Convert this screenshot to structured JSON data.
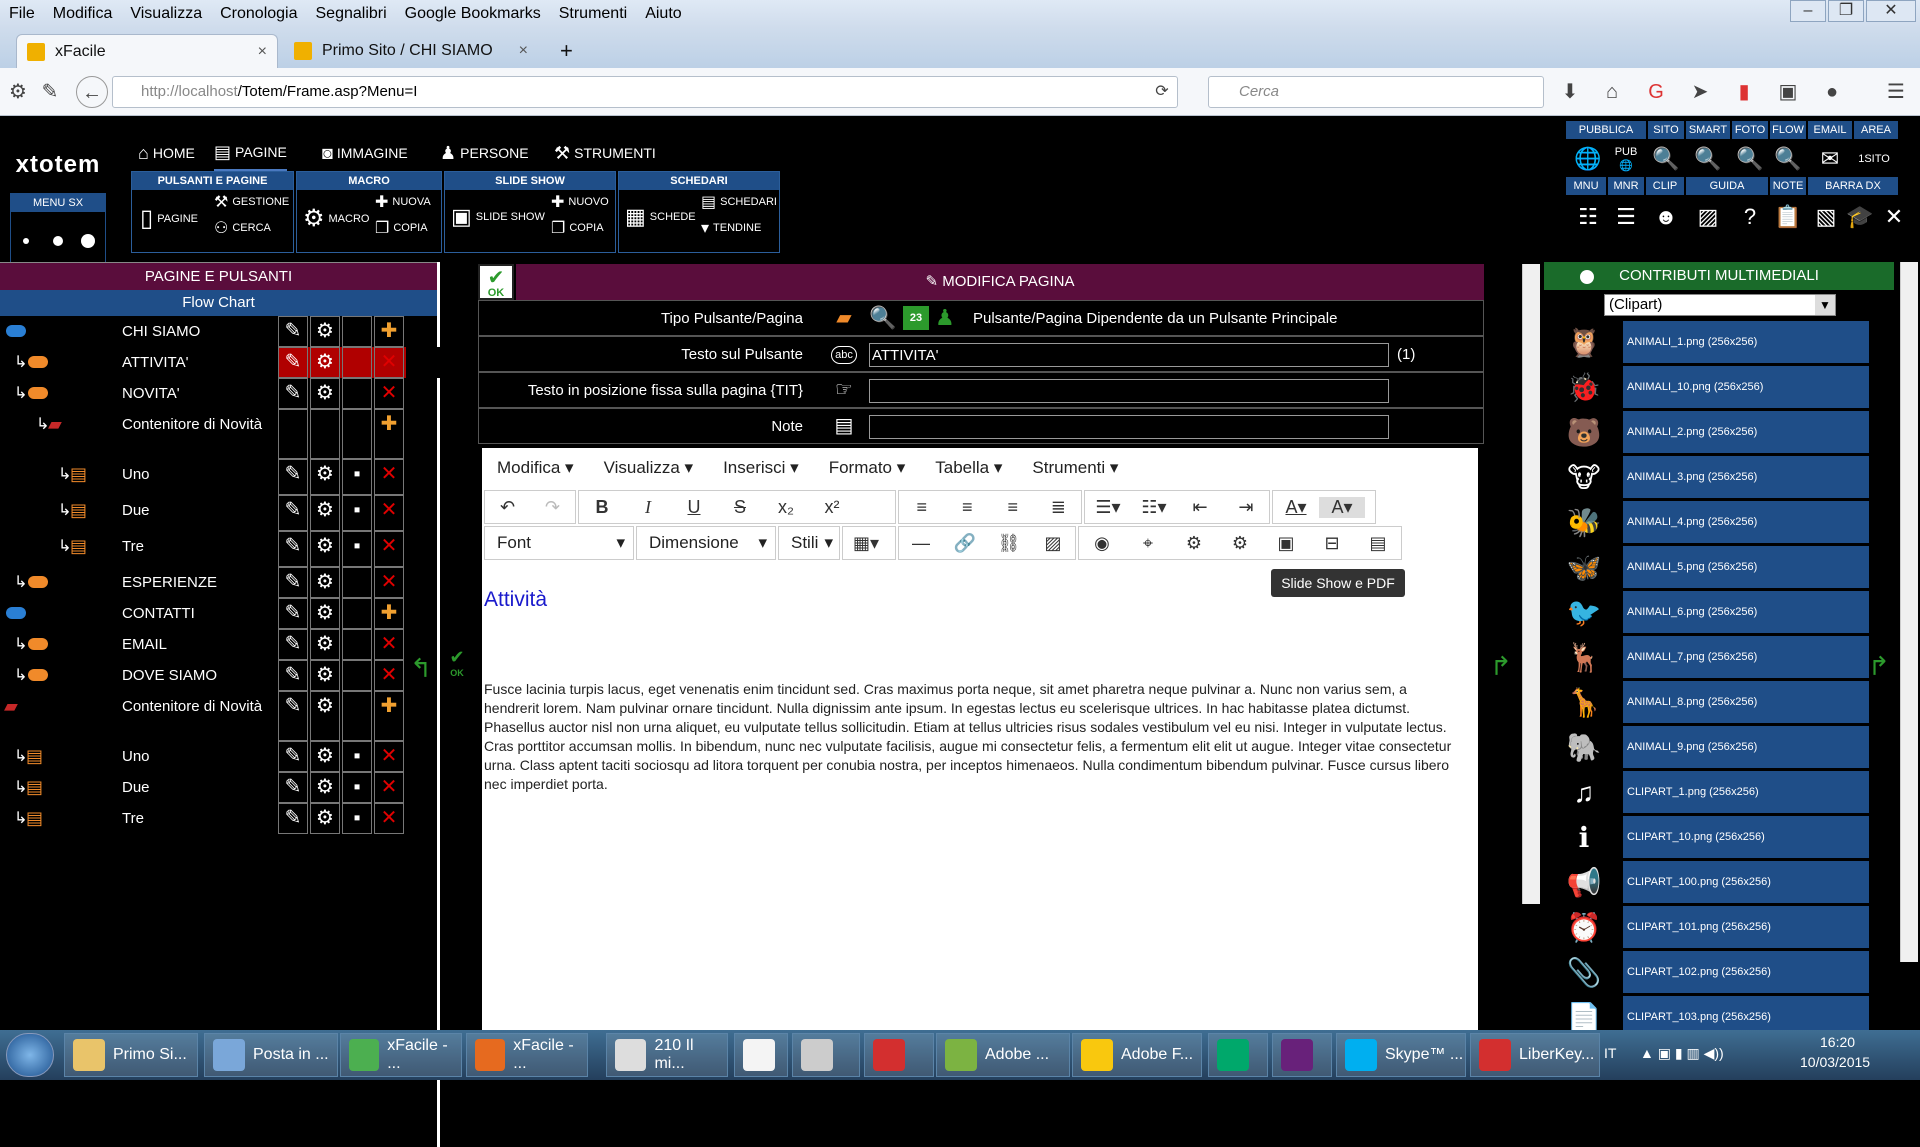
{
  "browser": {
    "menu": [
      "File",
      "Modifica",
      "Visualizza",
      "Cronologia",
      "Segnalibri",
      "Google Bookmarks",
      "Strumenti",
      "Aiuto"
    ],
    "tabs": [
      {
        "title": "xFacile",
        "close": "×"
      },
      {
        "title": "Primo Sito / CHI SIAMO",
        "close": "×"
      }
    ],
    "new_tab": "+",
    "url_host": "http://localhost",
    "url_path": "/Totem/Frame.asp?Menu=I",
    "search_placeholder": "Cerca",
    "window_controls": [
      "–",
      "❐",
      "✕"
    ]
  },
  "app": {
    "logo": "xtotem",
    "menu_sx_label": "MENU SX",
    "topnav": [
      {
        "icon": "home-icon",
        "label": "HOME"
      },
      {
        "icon": "page-icon",
        "label": "PAGINE"
      },
      {
        "icon": "camera-icon",
        "label": "IMMAGINE"
      },
      {
        "icon": "person-icon",
        "label": "PERSONE"
      },
      {
        "icon": "tools-icon",
        "label": "STRUMENTI"
      }
    ],
    "groups": {
      "pulsanti": {
        "title": "PULSANTI E PAGINE",
        "items": [
          "PAGINE",
          "GESTIONE",
          "CERCA"
        ]
      },
      "macro": {
        "title": "MACRO",
        "items": [
          "MACRO",
          "NUOVA",
          "COPIA"
        ]
      },
      "slideshow": {
        "title": "SLIDE SHOW",
        "items": [
          "SLIDE SHOW",
          "NUOVO",
          "COPIA"
        ]
      },
      "schedari": {
        "title": "SCHEDARI",
        "items": [
          "SCHEDE",
          "SCHEDARI",
          "TENDINE"
        ]
      }
    },
    "right_tools_row1": [
      "PUBBLICA",
      "SITO",
      "SMART",
      "FOTO",
      "FLOW",
      "EMAIL",
      "AREA"
    ],
    "right_tools_row2": [
      "MNU",
      "MNR",
      "CLIP",
      "GUIDA",
      "NOTE",
      "BARRA DX"
    ],
    "area_value": "1SITO",
    "pub_label": "PUB"
  },
  "left_panel": {
    "title": "PAGINE E PULSANTI",
    "subtitle": "Flow Chart",
    "rows": [
      {
        "label": "CHI SIAMO",
        "level": 0,
        "type": "main",
        "pill": "#2a7fd4",
        "selected": false,
        "actions": [
          "edit",
          "gear",
          "",
          "add"
        ]
      },
      {
        "label": "ATTIVITA'",
        "level": 1,
        "type": "sub",
        "pill": "#f08a2a",
        "selected": true,
        "actions": [
          "edit",
          "gear",
          "",
          "del"
        ]
      },
      {
        "label": "NOVITA'",
        "level": 1,
        "type": "sub",
        "pill": "#f08a2a",
        "selected": false,
        "actions": [
          "edit",
          "gear",
          "",
          "del"
        ]
      },
      {
        "label": "Contenitore di Novità",
        "level": 2,
        "type": "container",
        "pill": "",
        "selected": false,
        "actions": [
          "",
          "",
          "",
          "add"
        ]
      },
      {
        "label": "Uno",
        "level": 3,
        "type": "card",
        "pill": "",
        "selected": false,
        "actions": [
          "edit",
          "gear",
          "save",
          "del"
        ]
      },
      {
        "label": "Due",
        "level": 3,
        "type": "card",
        "pill": "",
        "selected": false,
        "actions": [
          "edit",
          "gear",
          "save",
          "del"
        ]
      },
      {
        "label": "Tre",
        "level": 3,
        "type": "card",
        "pill": "",
        "selected": false,
        "actions": [
          "edit",
          "gear",
          "save",
          "del"
        ]
      },
      {
        "label": "ESPERIENZE",
        "level": 1,
        "type": "sub",
        "pill": "#f08a2a",
        "selected": false,
        "actions": [
          "edit",
          "gear",
          "",
          "del"
        ]
      },
      {
        "label": "CONTATTI",
        "level": 0,
        "type": "main",
        "pill": "#2a7fd4",
        "selected": false,
        "actions": [
          "edit",
          "gear",
          "",
          "add"
        ]
      },
      {
        "label": "EMAIL",
        "level": 1,
        "type": "sub",
        "pill": "#f08a2a",
        "selected": false,
        "actions": [
          "edit",
          "gear",
          "",
          "del"
        ]
      },
      {
        "label": "DOVE SIAMO",
        "level": 1,
        "type": "sub",
        "pill": "#f08a2a",
        "selected": false,
        "actions": [
          "edit",
          "gear",
          "",
          "del"
        ]
      },
      {
        "label": "Contenitore di Novità",
        "level": 0,
        "type": "container",
        "pill": "",
        "selected": false,
        "actions": [
          "edit",
          "gear",
          "",
          "add"
        ]
      },
      {
        "label": "Uno",
        "level": 1,
        "type": "card",
        "pill": "",
        "selected": false,
        "actions": [
          "edit",
          "gear",
          "save",
          "del"
        ]
      },
      {
        "label": "Due",
        "level": 1,
        "type": "card",
        "pill": "",
        "selected": false,
        "actions": [
          "edit",
          "gear",
          "save",
          "del"
        ]
      },
      {
        "label": "Tre",
        "level": 1,
        "type": "card",
        "pill": "",
        "selected": false,
        "actions": [
          "edit",
          "gear",
          "save",
          "del"
        ]
      }
    ]
  },
  "mid_panel": {
    "ok_label": "OK",
    "title": "MODIFICA PAGINA",
    "fields": [
      {
        "label": "Tipo Pulsante/Pagina",
        "value": "Pulsante/Pagina Dipendente da un Pulsante Principale",
        "calendar_day": "23"
      },
      {
        "label": "Testo sul Pulsante",
        "value": "ATTIVITA'",
        "suffix": "(1)"
      },
      {
        "label": "Testo in posizione fissa sulla pagina {TIT}",
        "value": ""
      },
      {
        "label": "Note",
        "value": ""
      }
    ],
    "editor": {
      "menu": [
        "Modifica",
        "Visualizza",
        "Inserisci",
        "Formato",
        "Tabella",
        "Strumenti"
      ],
      "font_label": "Font",
      "size_label": "Dimensione",
      "styles_label": "Stili",
      "tooltip": "Slide Show e PDF",
      "content_title": "Attività",
      "content_text": "Fusce lacinia turpis lacus, eget venenatis enim tincidunt sed. Cras maximus porta neque, sit amet pharetra neque pulvinar a. Nunc non varius sem, a hendrerit lorem. Nam pulvinar ornare tincidunt. Nulla dignissim ante ipsum. In egestas lectus eu scelerisque ultrices. In hac habitasse platea dictumst. Phasellus auctor nisl non urna aliquet, eu vulputate tellus sollicitudin. Etiam at tellus ultricies risus sodales vestibulum vel eu nisi. Integer in vulputate lectus. Cras porttitor accumsan mollis. In bibendum, nunc nec vulputate facilisis, augue mi consectetur felis, a fermentum elit elit ut augue. Integer vitae consectetur urna. Class aptent taciti sociosqu ad litora torquent per conubia nostra, per inceptos himenaeos. Nulla condimentum bibendum pulvinar. Fusce cursus libero nec imperdiet porta."
    }
  },
  "right_panel": {
    "title": "CONTRIBUTI MULTIMEDIALI",
    "category": "(Clipart)",
    "items": [
      {
        "name": "ANIMALI_1.png (256x256)",
        "icon": "🦉"
      },
      {
        "name": "ANIMALI_10.png (256x256)",
        "icon": "🐞"
      },
      {
        "name": "ANIMALI_2.png (256x256)",
        "icon": "🐻"
      },
      {
        "name": "ANIMALI_3.png (256x256)",
        "icon": "🐮"
      },
      {
        "name": "ANIMALI_4.png (256x256)",
        "icon": "🐝"
      },
      {
        "name": "ANIMALI_5.png (256x256)",
        "icon": "🦋"
      },
      {
        "name": "ANIMALI_6.png (256x256)",
        "icon": "🐦"
      },
      {
        "name": "ANIMALI_7.png (256x256)",
        "icon": "🦌"
      },
      {
        "name": "ANIMALI_8.png (256x256)",
        "icon": "🦒"
      },
      {
        "name": "ANIMALI_9.png (256x256)",
        "icon": "🐘"
      },
      {
        "name": "CLIPART_1.png (256x256)",
        "icon": "♫"
      },
      {
        "name": "CLIPART_10.png (256x256)",
        "icon": "ℹ"
      },
      {
        "name": "CLIPART_100.png (256x256)",
        "icon": "📢"
      },
      {
        "name": "CLIPART_101.png (256x256)",
        "icon": "⏰"
      },
      {
        "name": "CLIPART_102.png (256x256)",
        "icon": "📎"
      },
      {
        "name": "CLIPART_103.png (256x256)",
        "icon": "📄"
      }
    ]
  },
  "taskbar": {
    "tasks": [
      {
        "label": "Primo Si...",
        "color": "#e9c46a"
      },
      {
        "label": "Posta in ...",
        "color": "#7aa7d9"
      },
      {
        "label": "xFacile - ...",
        "color": "#4caf50"
      },
      {
        "label": "xFacile - ...",
        "color": "#e66a1f"
      },
      {
        "label": "210 Il mi...",
        "color": "#dddddd"
      },
      {
        "label": "",
        "color": "#f4f4f4"
      },
      {
        "label": "",
        "color": "#cccccc"
      },
      {
        "label": "",
        "color": "#d32f2f"
      },
      {
        "label": "Adobe ...",
        "color": "#7cb342"
      },
      {
        "label": "Adobe F...",
        "color": "#f9c80e"
      },
      {
        "label": "",
        "color": "#00a86b"
      },
      {
        "label": "",
        "color": "#68217a"
      },
      {
        "label": "Skype™ ...",
        "color": "#00aff0"
      },
      {
        "label": "LiberKey...",
        "color": "#d32f2f"
      }
    ],
    "lang": "IT",
    "time": "16:20",
    "date": "10/03/2015"
  }
}
